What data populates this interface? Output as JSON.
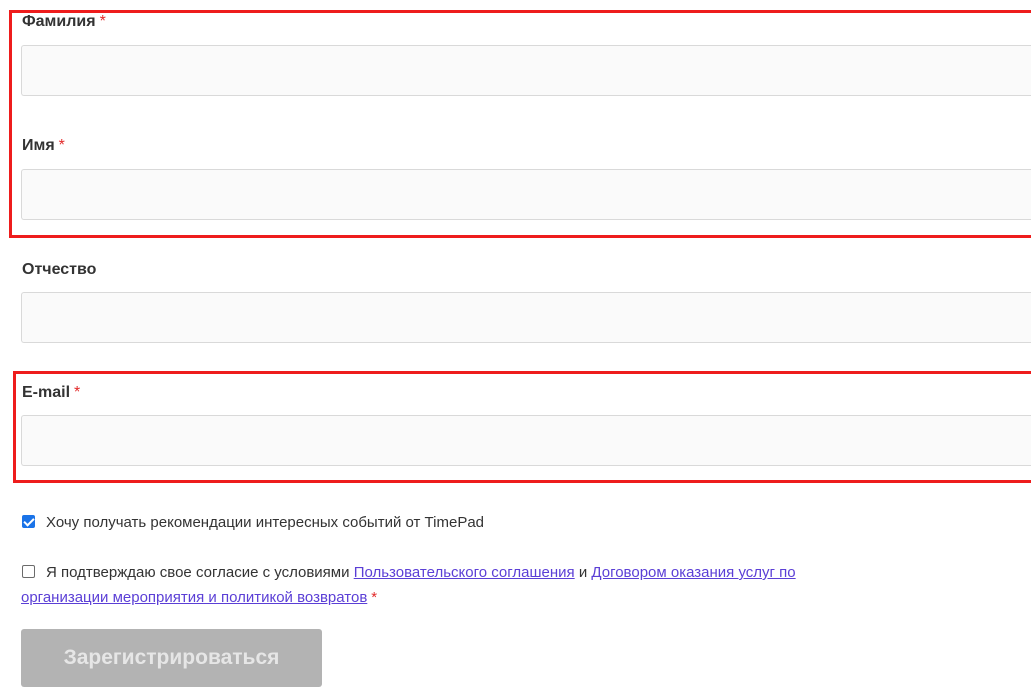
{
  "form": {
    "last_name": {
      "label": "Фамилия",
      "required_mark": "*",
      "value": ""
    },
    "first_name": {
      "label": "Имя",
      "required_mark": "*",
      "value": ""
    },
    "middle_name": {
      "label": "Отчество",
      "value": ""
    },
    "email": {
      "label": "E-mail",
      "required_mark": "*",
      "value": ""
    },
    "subscribe": {
      "checked": true,
      "text": "Хочу получать рекомендации интересных событий от TimePad"
    },
    "consent": {
      "checked": false,
      "text_before": "Я подтверждаю свое согласие с условиями",
      "link_user_agreement": "Пользовательского соглашения",
      "conjunction": "и",
      "link_contract_line1": "Договором оказания услуг по",
      "link_contract_line2": "организации мероприятия и политикой возвратов",
      "required_mark": "*"
    },
    "submit_label": "Зарегистрироваться"
  },
  "colors": {
    "highlight": "#ee1c1c",
    "required": "#e22a2a",
    "link": "#5b3fd6",
    "checkbox_checked": "#1a73e8",
    "submit_disabled_bg": "#b3b3b3"
  }
}
